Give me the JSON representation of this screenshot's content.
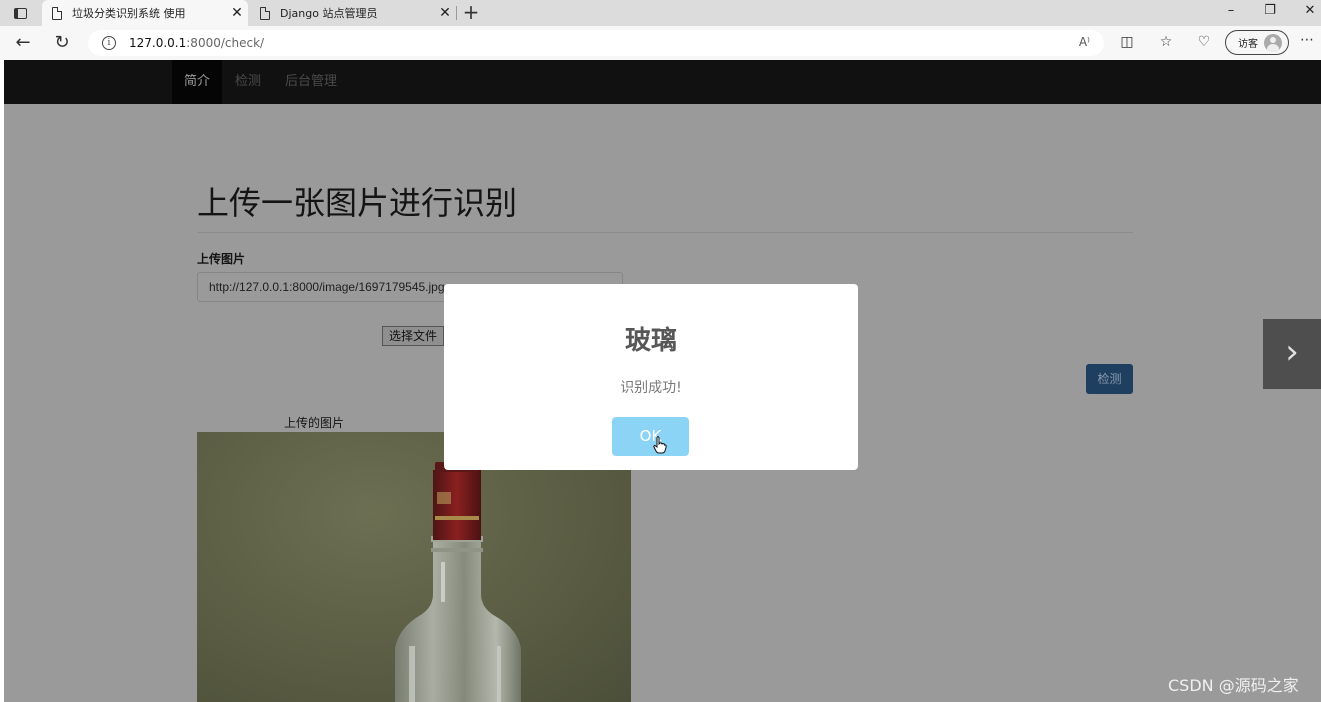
{
  "browser": {
    "tabs": [
      {
        "title": "垃圾分类识别系统 使用",
        "active": true
      },
      {
        "title": "Django 站点管理员",
        "active": false
      }
    ],
    "new_tab_icon": "plus-icon",
    "address": {
      "host": "127.0.0.1",
      "path": ":8000/check/"
    },
    "read_aloud_label": "A⁾",
    "guest_label": "访客",
    "window_controls": {
      "minimize": "–",
      "restore": "❐",
      "close": "✕"
    }
  },
  "navbar": {
    "items": [
      {
        "label": "简介",
        "active": true
      },
      {
        "label": "检测",
        "active": false
      },
      {
        "label": "后台管理",
        "active": false
      }
    ]
  },
  "main": {
    "heading": "上传一张图片进行识别",
    "upload_label": "上传图片",
    "image_url_value": "http://127.0.0.1:8000/image/1697179545.jpg",
    "file_button_label": "选择文件",
    "detect_button_label": "检测",
    "uploaded_image_caption": "上传的图片"
  },
  "modal": {
    "title": "玻璃",
    "message": "识别成功!",
    "ok_label": "OK"
  },
  "carousel": {
    "next_icon": "chevron-right-icon"
  },
  "watermark": "CSDN @源码之家",
  "colors": {
    "overlay_page": "#9a9a9a",
    "navbar": "#111111",
    "ok_button": "#8cd4f5",
    "detect_button": "#1e3f5f"
  }
}
